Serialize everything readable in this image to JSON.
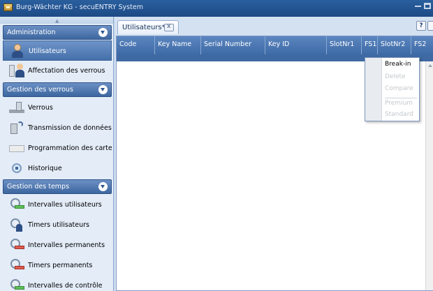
{
  "window": {
    "title": "Burg-Wächter KG - secuENTRY System"
  },
  "sidebar": {
    "sections": [
      {
        "header": "Administration",
        "items": [
          {
            "label": "Utilisateurs",
            "icon": "user-icon",
            "active": true
          },
          {
            "label": "Affectation des verrous",
            "icon": "lock-assignment-icon"
          }
        ]
      },
      {
        "header": "Gestion des verrous",
        "items": [
          {
            "label": "Verrous",
            "icon": "lock-icon"
          },
          {
            "label": "Transmission de données",
            "icon": "data-transmission-icon"
          },
          {
            "label": "Programmation des cartes in",
            "icon": "card-programming-icon"
          },
          {
            "label": "Historique",
            "icon": "history-icon"
          }
        ]
      },
      {
        "header": "Gestion des temps",
        "items": [
          {
            "label": "Intervalles utilisateurs",
            "icon": "user-interval-icon"
          },
          {
            "label": "Timers utilisateurs",
            "icon": "user-timer-icon"
          },
          {
            "label": "Intervalles permanents",
            "icon": "permanent-interval-icon"
          },
          {
            "label": "Timers permanents",
            "icon": "permanent-timer-icon"
          },
          {
            "label": "Intervalles de contrôle",
            "icon": "control-interval-icon"
          }
        ]
      }
    ]
  },
  "main": {
    "tab": {
      "label": "Utilisateurs*"
    },
    "help_label": "?",
    "table": {
      "columns": [
        "Code",
        "Key Name",
        "Serial Number",
        "Key ID",
        "SlotNr1",
        "FS1",
        "SlotNr2",
        "FS2"
      ]
    }
  },
  "context_menu": {
    "items": [
      {
        "label": "Break-in",
        "enabled": true
      },
      {
        "label": "Delete",
        "enabled": false
      },
      {
        "label": "Compare",
        "enabled": false
      },
      {
        "label": "Premium",
        "enabled": false
      },
      {
        "label": "Standard",
        "enabled": false
      }
    ]
  },
  "colors": {
    "header_blue": "#3e6aa6",
    "sidebar_bg": "#e3ecf7",
    "titlebar": "#1c4a85"
  }
}
